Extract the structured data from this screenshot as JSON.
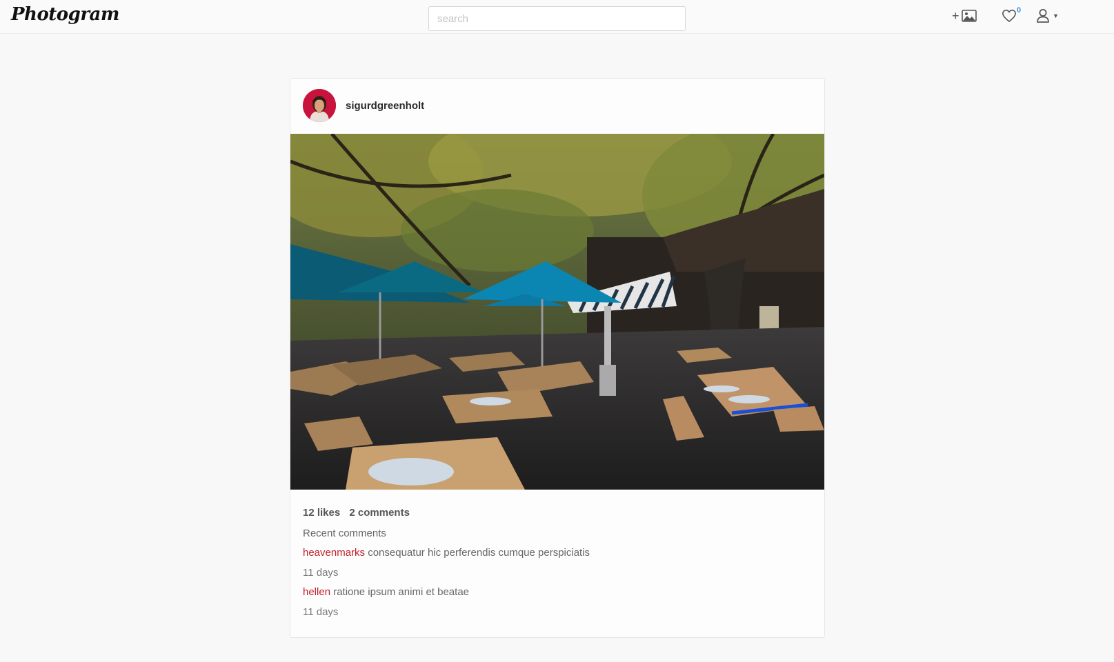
{
  "app": {
    "brand": "Photogram"
  },
  "search": {
    "placeholder": "search",
    "value": ""
  },
  "nav": {
    "upload_icon": "add-image-icon",
    "likes_icon": "heart-icon",
    "likes_count": "0",
    "user_icon": "user-icon",
    "accent_color": "#3b8fe0"
  },
  "post": {
    "username": "sigurdgreenholt",
    "likes": "12 likes",
    "comments_count": "2 comments",
    "recent_label": "Recent comments",
    "comments": [
      {
        "author": "heavenmarks",
        "text": "consequatur hic perferendis cumque perspiciatis",
        "time": "11 days"
      },
      {
        "author": "hellen",
        "text": "ratione ipsum animi et beatae",
        "time": "11 days"
      }
    ],
    "author_color": "#c0202a"
  }
}
